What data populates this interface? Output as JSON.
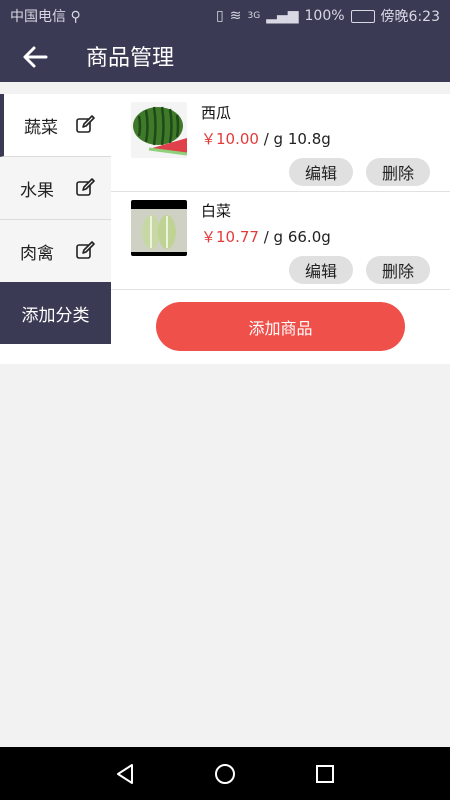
{
  "status_bar": {
    "carrier": "中国电信",
    "network": "3G",
    "battery": "100%",
    "time": "傍晚6:23"
  },
  "header": {
    "title": "商品管理"
  },
  "sidebar": {
    "categories": [
      {
        "label": "蔬菜",
        "active": true
      },
      {
        "label": "水果",
        "active": false
      },
      {
        "label": "肉禽",
        "active": false
      }
    ],
    "add_category_label": "添加分类"
  },
  "products": [
    {
      "name": "西瓜",
      "price": "￥10.00",
      "unit": " / g 10.8g",
      "edit_label": "编辑",
      "delete_label": "删除"
    },
    {
      "name": "白菜",
      "price": "￥10.77",
      "unit": " / g 66.0g",
      "edit_label": "编辑",
      "delete_label": "删除"
    }
  ],
  "add_product_label": "添加商品",
  "colors": {
    "header_bg": "#3a3a54",
    "accent_red": "#f0504a",
    "price_red": "#e23b3b"
  }
}
